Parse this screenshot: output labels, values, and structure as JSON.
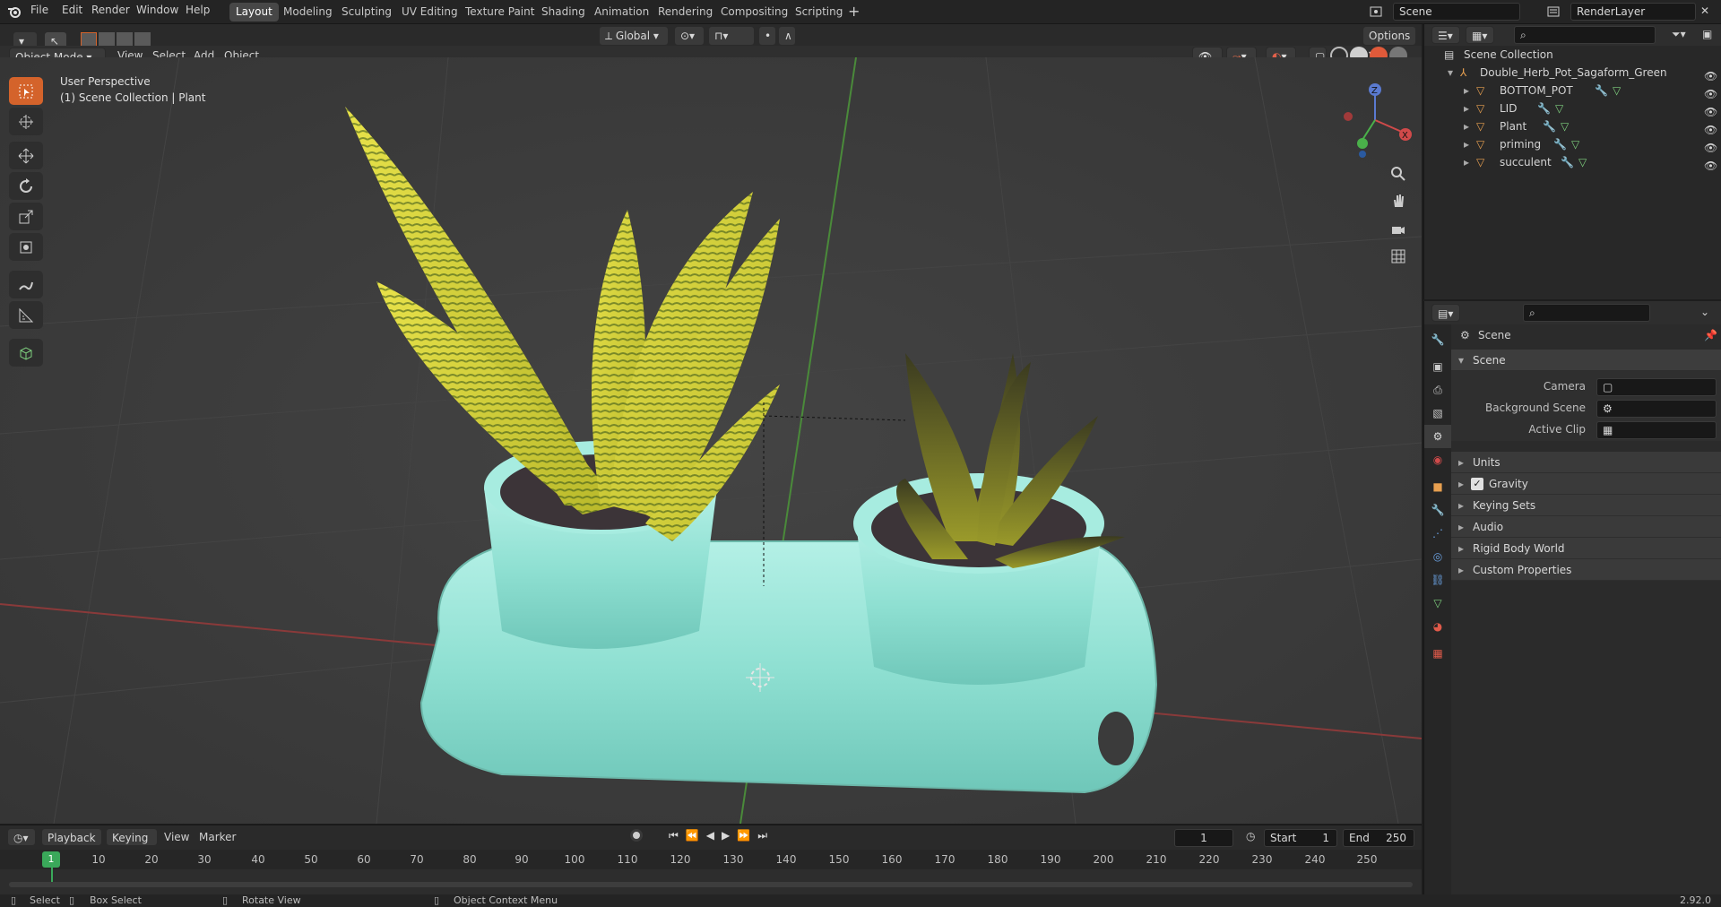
{
  "top_menu": [
    "File",
    "Edit",
    "Render",
    "Window",
    "Help"
  ],
  "workspace_tabs": [
    "Layout",
    "Modeling",
    "Sculpting",
    "UV Editing",
    "Texture Paint",
    "Shading",
    "Animation",
    "Rendering",
    "Compositing",
    "Scripting"
  ],
  "active_tab": "Layout",
  "scene_field": "Scene",
  "render_layer_field": "RenderLayer",
  "viewport_header": {
    "mode": "Object Mode",
    "menus": [
      "View",
      "Select",
      "Add",
      "Object"
    ],
    "transform_orientation": "Global",
    "options_label": "Options"
  },
  "viewport_overlay": {
    "line1": "User Perspective",
    "line2": "(1) Scene Collection | Plant"
  },
  "gizmo": {
    "z": "Z",
    "x": "X",
    "y": "Y"
  },
  "outliner": {
    "root": "Scene Collection",
    "collection": "Double_Herb_Pot_Sagaform_Green",
    "objects": [
      "BOTTOM_POT",
      "LID",
      "Plant",
      "priming",
      "succulent"
    ]
  },
  "properties": {
    "context": "Scene",
    "panel_title": "Scene",
    "camera_label": "Camera",
    "background_scene_label": "Background Scene",
    "active_clip_label": "Active Clip",
    "subpanels": [
      "Units",
      "Gravity",
      "Keying Sets",
      "Audio",
      "Rigid Body World",
      "Custom Properties"
    ],
    "gravity_checked": true
  },
  "timeline": {
    "menus": [
      "Playback",
      "Keying",
      "View",
      "Marker"
    ],
    "current_frame": "1",
    "start_label": "Start",
    "start_value": "1",
    "end_label": "End",
    "end_value": "250",
    "ticks": [
      "10",
      "20",
      "30",
      "40",
      "50",
      "60",
      "70",
      "80",
      "90",
      "100",
      "110",
      "120",
      "130",
      "140",
      "150",
      "160",
      "170",
      "180",
      "190",
      "200",
      "210",
      "220",
      "230",
      "240",
      "250"
    ],
    "playhead_label": "1"
  },
  "statusbar": {
    "select": "Select",
    "box_select": "Box Select",
    "rotate_view": "Rotate View",
    "context_menu": "Object Context Menu",
    "version": "2.92.0"
  },
  "colors": {
    "accent": "#d4632b",
    "pot": "#8ee0d2",
    "leaf_yellow": "#d6d436",
    "leaf_green": "#5d6b1f"
  }
}
